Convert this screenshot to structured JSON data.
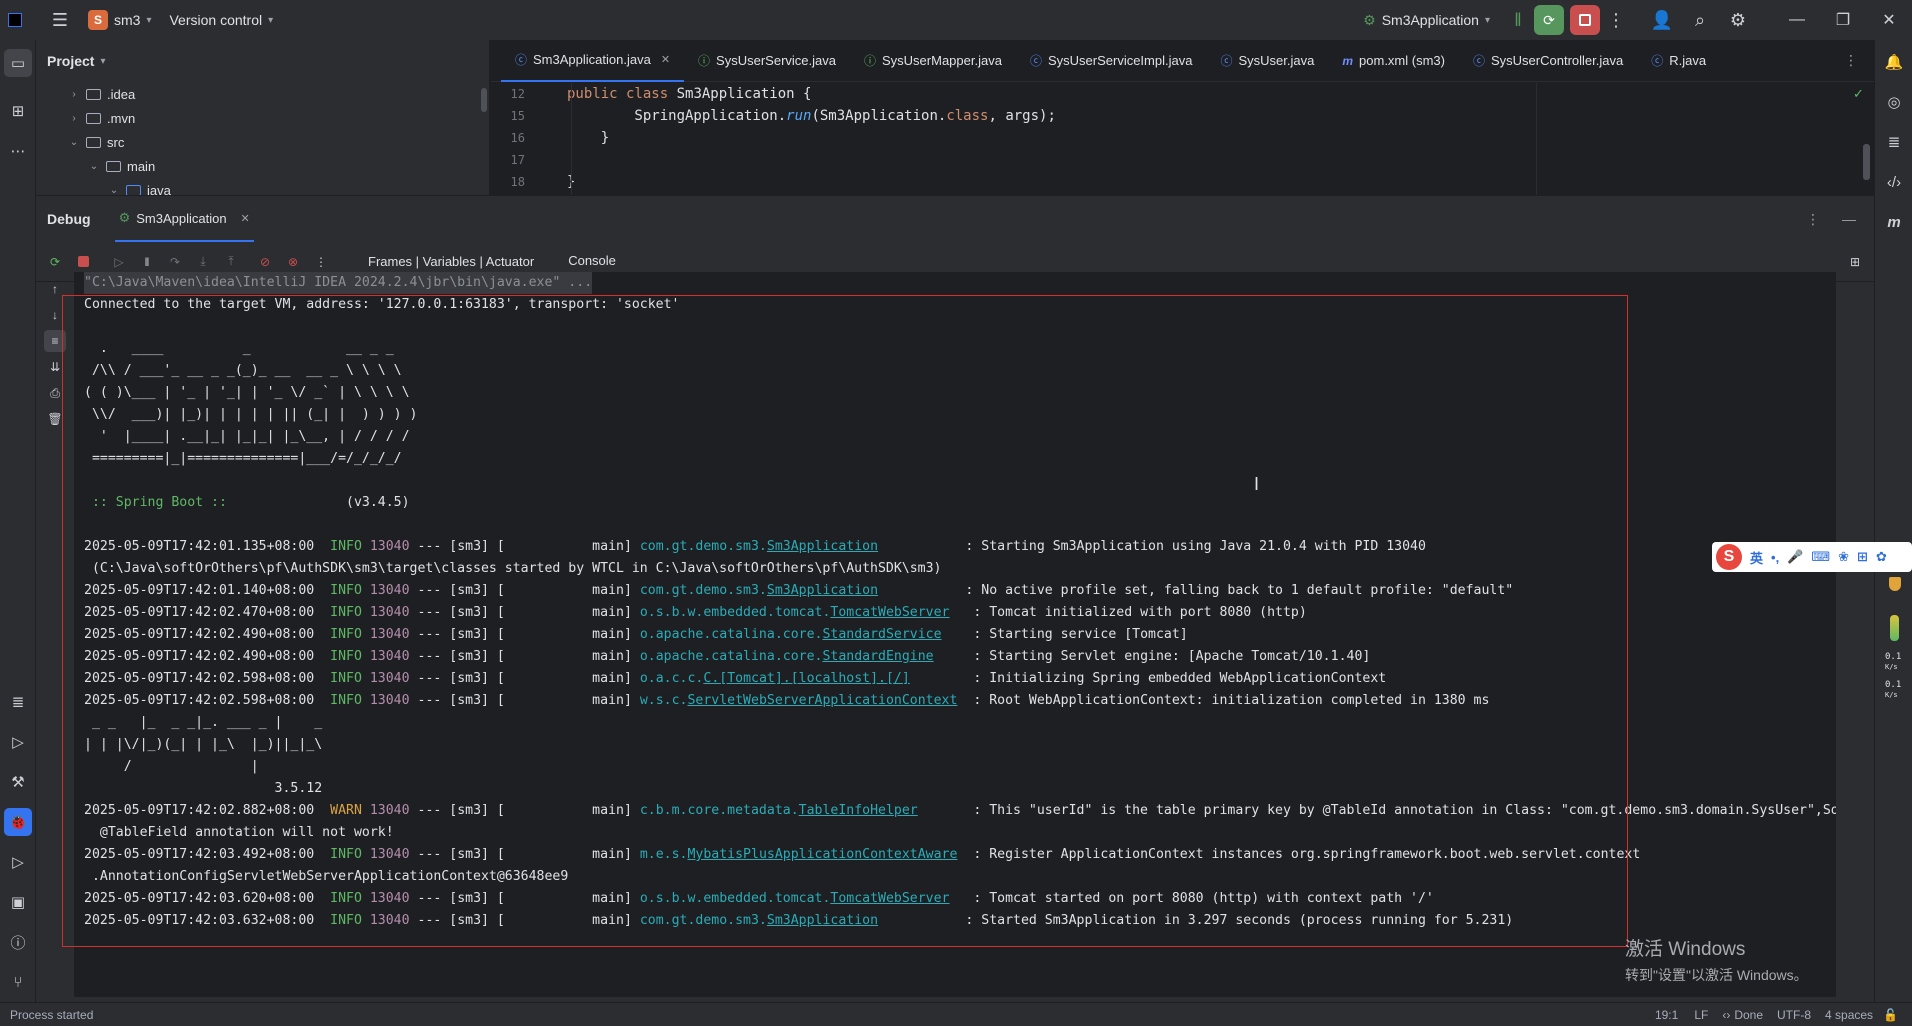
{
  "titlebar": {
    "project_badge": "S",
    "project_name": "sm3",
    "vcs": "Version control",
    "run_config": "Sm3Application"
  },
  "project_panel": {
    "title": "Project",
    "tree": [
      {
        "label": ".idea",
        "expanded": false
      },
      {
        "label": ".mvn",
        "expanded": false
      },
      {
        "label": "src",
        "expanded": true
      },
      {
        "label": "main",
        "expanded": true
      },
      {
        "label": "java",
        "expanded": true
      }
    ]
  },
  "editor": {
    "tabs": [
      {
        "label": "Sm3Application.java",
        "icon": "java-class-icon",
        "active": true
      },
      {
        "label": "SysUserService.java",
        "icon": "interface-icon",
        "active": false
      },
      {
        "label": "SysUserMapper.java",
        "icon": "interface-icon",
        "active": false
      },
      {
        "label": "SysUserServiceImpl.java",
        "icon": "class-icon",
        "active": false
      },
      {
        "label": "SysUser.java",
        "icon": "class-icon",
        "active": false
      },
      {
        "label": "pom.xml (sm3)",
        "icon": "maven-icon",
        "active": false
      },
      {
        "label": "SysUserController.java",
        "icon": "class-icon",
        "active": false
      },
      {
        "label": "R.java",
        "icon": "class-icon",
        "active": false
      }
    ],
    "lines": [
      {
        "num": "12",
        "kw": "public class",
        "text": " Sm3Application {"
      },
      {
        "num": "15",
        "pre": "        SpringApplication.",
        "fn": "run",
        "mid": "(Sm3Application.",
        "cl": "class",
        "post": ", args);"
      },
      {
        "num": "16",
        "text": "    }"
      },
      {
        "num": "17",
        "text": ""
      },
      {
        "num": "18",
        "text": "}"
      }
    ]
  },
  "debug": {
    "title": "Debug",
    "session_tab": "Sm3Application",
    "view_tabs": [
      "Frames | Variables | Actuator",
      "Console"
    ],
    "active_view": "Console",
    "cmd_line": "\"C:\\Java\\Maven\\idea\\IntelliJ IDEA 2024.2.4\\jbr\\bin\\java.exe\" ...",
    "connected": "Connected to the target VM, address: '127.0.0.1:63183', transport: 'socket'",
    "spring_banner": [
      "  .   ____          _            __ _ _",
      " /\\\\ / ___'_ __ _ _(_)_ __  __ _ \\ \\ \\ \\",
      "( ( )\\___ | '_ | '_| | '_ \\/ _` | \\ \\ \\ \\",
      " \\\\/  ___)| |_)| | | | | || (_| |  ) ) ) )",
      "  '  |____| .__|_| |_|_| |_\\__, | / / / /",
      " =========|_|==============|___/=/_/_/_/"
    ],
    "spring_boot_label": " :: Spring Boot ::",
    "spring_boot_version": "(v3.4.5)",
    "mp_banner": [
      " _ _   |_  _ _|_. ___ _ |    _",
      "| | |\\/|_)(_| | |_\\  |_)||_|_\\",
      "     /               |",
      "                        3.5.12"
    ],
    "logs": [
      {
        "ts": "2025-05-09T17:42:01.135+08:00",
        "level": "INFO",
        "pid": "13040",
        "thread": "--- [sm3] [           main]",
        "logger_pre": "com.gt.demo.sm3.",
        "logger_cls": "Sm3Application",
        "pad": "          ",
        "msg": ": Starting Sm3Application using Java 21.0.4 with PID 13040"
      },
      {
        "cont": " (C:\\Java\\softOrOthers\\pf\\AuthSDK\\sm3\\target\\classes started by WTCL in C:\\Java\\softOrOthers\\pf\\AuthSDK\\sm3)"
      },
      {
        "ts": "2025-05-09T17:42:01.140+08:00",
        "level": "INFO",
        "pid": "13040",
        "thread": "--- [sm3] [           main]",
        "logger_pre": "com.gt.demo.sm3.",
        "logger_cls": "Sm3Application",
        "pad": "          ",
        "msg": ": No active profile set, falling back to 1 default profile: \"default\""
      },
      {
        "ts": "2025-05-09T17:42:02.470+08:00",
        "level": "INFO",
        "pid": "13040",
        "thread": "--- [sm3] [           main]",
        "logger_pre": "o.s.b.w.embedded.tomcat.",
        "logger_cls": "TomcatWebServer",
        "pad": "  ",
        "msg": ": Tomcat initialized with port 8080 (http)"
      },
      {
        "ts": "2025-05-09T17:42:02.490+08:00",
        "level": "INFO",
        "pid": "13040",
        "thread": "--- [sm3] [           main]",
        "logger_pre": "o.apache.catalina.core.",
        "logger_cls": "StandardService",
        "pad": "   ",
        "msg": ": Starting service [Tomcat]"
      },
      {
        "ts": "2025-05-09T17:42:02.490+08:00",
        "level": "INFO",
        "pid": "13040",
        "thread": "--- [sm3] [           main]",
        "logger_pre": "o.apache.catalina.core.",
        "logger_cls": "StandardEngine",
        "pad": "    ",
        "msg": ": Starting Servlet engine: [Apache Tomcat/10.1.40]"
      },
      {
        "ts": "2025-05-09T17:42:02.598+08:00",
        "level": "INFO",
        "pid": "13040",
        "thread": "--- [sm3] [           main]",
        "logger_pre": "o.a.c.c.",
        "logger_cls": "C.[Tomcat].[localhost].[/]",
        "pad": "       ",
        "msg": ": Initializing Spring embedded WebApplicationContext"
      },
      {
        "ts": "2025-05-09T17:42:02.598+08:00",
        "level": "INFO",
        "pid": "13040",
        "thread": "--- [sm3] [           main]",
        "logger_pre": "w.s.c.",
        "logger_cls": "ServletWebServerApplicationContext",
        "pad": " ",
        "msg": ": Root WebApplicationContext: initialization completed in 1380 ms"
      },
      {
        "ts": "2025-05-09T17:42:02.882+08:00",
        "level": "WARN",
        "pid": "13040",
        "thread": "--- [sm3] [           main]",
        "logger_pre": "c.b.m.core.metadata.",
        "logger_cls": "TableInfoHelper",
        "pad": "      ",
        "msg": ": This \"userId\" is the table primary key by @TableId annotation in Class: \"com.gt.demo.sm3.domain.SysUser\",So"
      },
      {
        "cont": "  @TableField annotation will not work!"
      },
      {
        "ts": "2025-05-09T17:42:03.492+08:00",
        "level": "INFO",
        "pid": "13040",
        "thread": "--- [sm3] [           main]",
        "logger_pre": "m.e.s.",
        "logger_cls": "MybatisPlusApplicationContextAware",
        "pad": " ",
        "msg": ": Register ApplicationContext instances org.springframework.boot.web.servlet.context"
      },
      {
        "cont": " .AnnotationConfigServletWebServerApplicationContext@63648ee9"
      },
      {
        "ts": "2025-05-09T17:42:03.620+08:00",
        "level": "INFO",
        "pid": "13040",
        "thread": "--- [sm3] [           main]",
        "logger_pre": "o.s.b.w.embedded.tomcat.",
        "logger_cls": "TomcatWebServer",
        "pad": "  ",
        "msg": ": Tomcat started on port 8080 (http) with context path '/'"
      },
      {
        "ts": "2025-05-09T17:42:03.632+08:00",
        "level": "INFO",
        "pid": "13040",
        "thread": "--- [sm3] [           main]",
        "logger_pre": "com.gt.demo.sm3.",
        "logger_cls": "Sm3Application",
        "pad": "          ",
        "msg": ": Started Sm3Application in 3.297 seconds (process running for 5.231)"
      }
    ]
  },
  "statusbar": {
    "left": "Process started",
    "position": "19:1",
    "line_sep": "LF",
    "vcs_status": "Done",
    "encoding": "UTF-8",
    "indent": "4 spaces"
  },
  "ime": {
    "lang": "英",
    "net1": "0.1",
    "net2": "0.1",
    "unit": "K/s"
  },
  "watermark": {
    "line1": "激活 Windows",
    "line2": "转到\"设置\"以激活 Windows。"
  },
  "colors": {
    "accent": "#3574f0",
    "debug_green": "#57965c",
    "stop_red": "#c94f4f",
    "annotation_box": "#d0312d"
  }
}
